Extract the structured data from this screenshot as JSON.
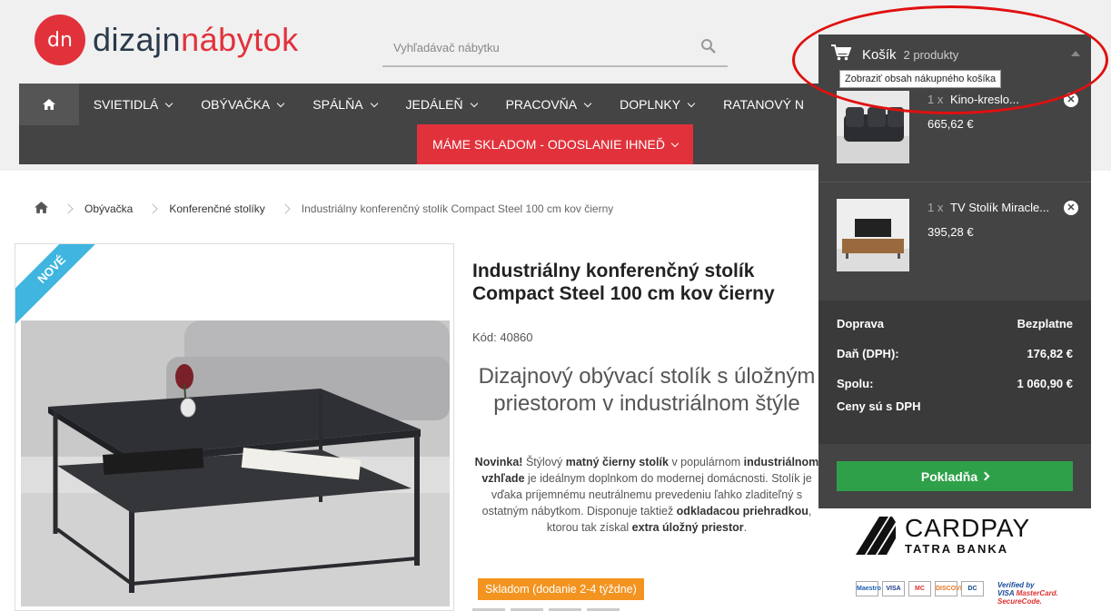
{
  "logo": {
    "mark": "dn",
    "text_a": "dizajn",
    "text_b": "nábytok"
  },
  "search": {
    "placeholder": "Vyhľadávač nábytku"
  },
  "nav": {
    "items": [
      "SVIETIDLÁ",
      "OBÝVAČKA",
      "SPÁLŇA",
      "JEDÁLEŇ",
      "PRACOVŇA",
      "DOPLNKY",
      "RATANOVÝ N"
    ],
    "stock_label": "MÁME SKLADOM - ODOSLANIE IHNEĎ"
  },
  "breadcrumb": {
    "items": [
      "Obývačka",
      "Konferenčné stolíky"
    ],
    "current": "Industriálny konferenčný stolík Compact Steel 100 cm kov čierny"
  },
  "product": {
    "ribbon": "NOVÉ",
    "title": "Industriálny konferenčný stolík Compact Steel 100 cm kov čierny",
    "code": "Kód: 40860",
    "subtitle": "Dizajnový obývací stolík s úložným priestorom v industriálnom štýle",
    "desc": {
      "p1": "Novinka!",
      "p2": " Štýlový ",
      "p3": "matný čierny stolík",
      "p4": " v populárnom ",
      "p5": "industriálnom vzhľade",
      "p6": " je ideálnym doplnkom do modernej domácnosti. Stolík je vďaka príjemnému neutrálnemu prevedeniu ľahko zladiteľný s ostatným nábytkom. Disponuje taktiež ",
      "p7": "odkladacou priehradkou",
      "p8": ", ktorou tak získal ",
      "p9": "extra úložný priestor",
      "p10": "."
    },
    "stock": "Skladom (dodanie 2-4 týždne)"
  },
  "cart": {
    "title": "Košík",
    "count": "2 produkty",
    "tooltip": "Zobraziť obsah nákupného košíka",
    "items": [
      {
        "qty": "1 x",
        "name": "Kino-kreslo...",
        "price": "665,62 €"
      },
      {
        "qty": "1 x",
        "name": "TV Stolík Miracle...",
        "price": "395,28 €"
      }
    ],
    "totals": {
      "shipping_label": "Doprava",
      "shipping_value": "Bezplatne",
      "tax_label": "Daň (DPH):",
      "tax_value": "176,82 €",
      "total_label": "Spolu:",
      "total_value": "1 060,90 €",
      "note": "Ceny sú s DPH"
    },
    "checkout": "Pokladňa"
  },
  "payment": {
    "cardpay": "CARDPAY",
    "bank": "TATRA BANKA",
    "cards": [
      "Maestro",
      "VISA",
      "MC",
      "DISCOVER",
      "DC"
    ],
    "verified_1": "Verified by",
    "verified_2": "VISA",
    "verified_3": "MasterCard.",
    "verified_4": "SecureCode."
  },
  "colors": {
    "brand_red": "#e1323c",
    "nav_bg": "#444444",
    "checkout_green": "#2fa04a",
    "stock_orange": "#f39420",
    "ribbon_blue": "#3fb5e0"
  }
}
